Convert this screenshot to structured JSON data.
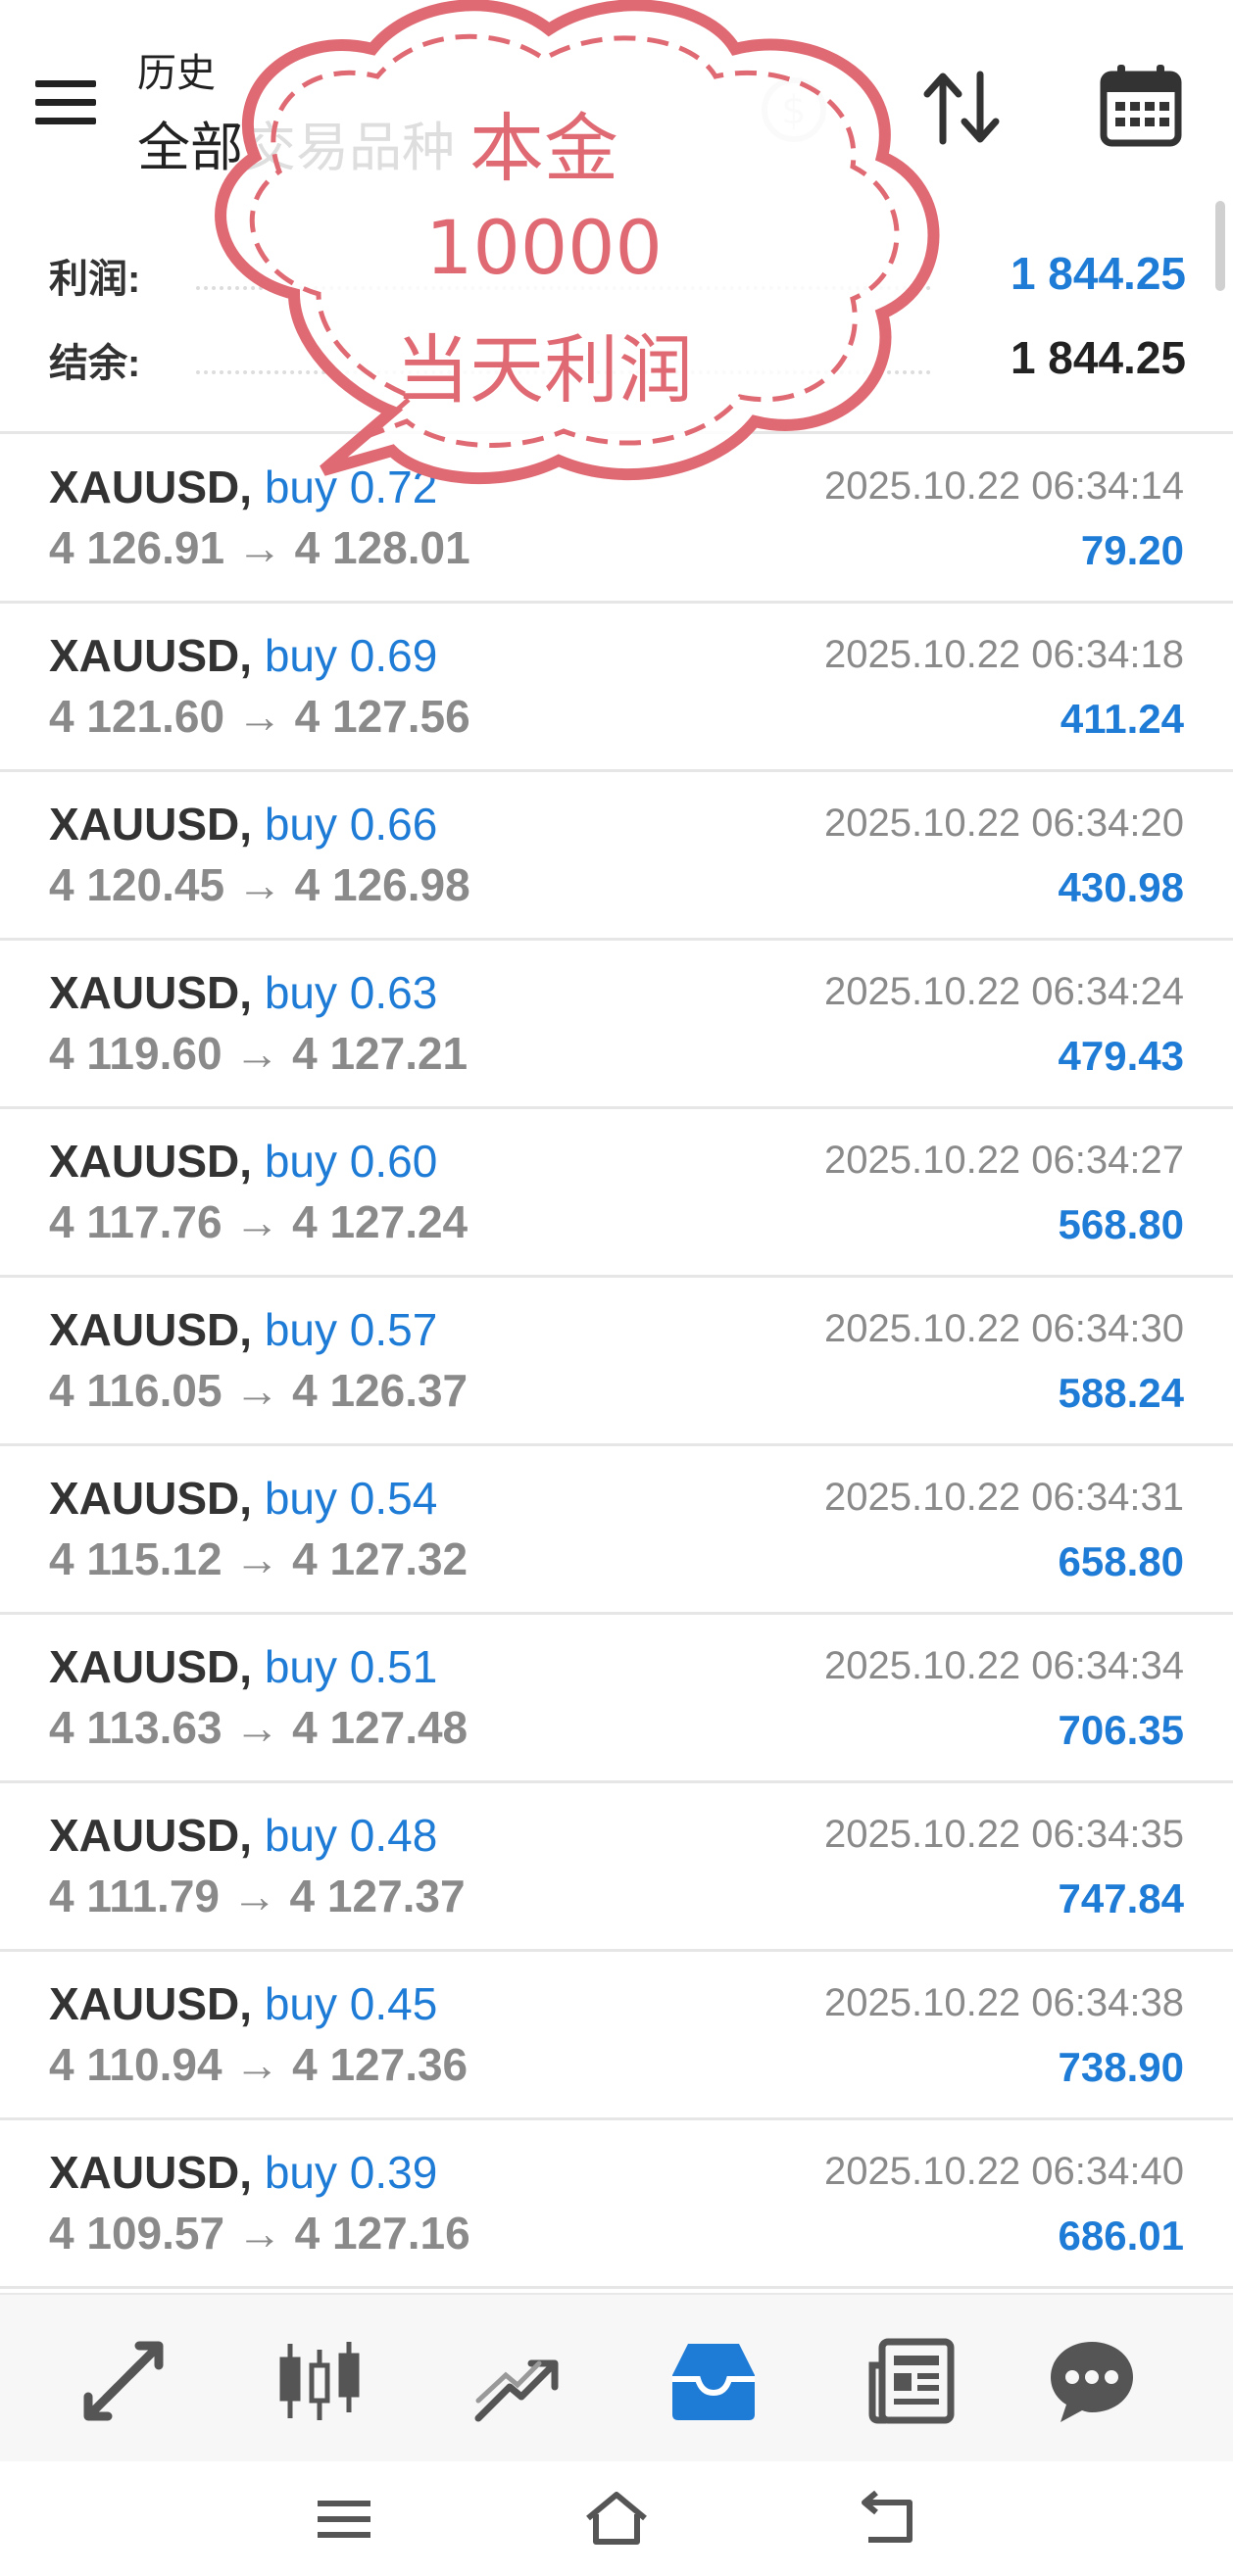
{
  "header": {
    "title_small": "历史",
    "title_big": "全部交易品种",
    "icons": [
      "menu-icon",
      "money-icon",
      "sort-icon",
      "calendar-icon"
    ]
  },
  "summary": {
    "profit_label": "利润:",
    "profit_value": "1 844.25",
    "balance_label": "结余:",
    "balance_value": "1 844.25"
  },
  "overlay": {
    "line1": "本金",
    "line2": "10000",
    "line3": "当天利润",
    "color": "#e06a73"
  },
  "colors": {
    "accent": "#1e7bd6",
    "muted": "#8a8a8a",
    "text": "#333333"
  },
  "trades": [
    {
      "symbol": "XAUUSD,",
      "side": "buy 0.72",
      "prices": "4 126.91 → 4 128.01",
      "time": "2025.10.22 06:34:14",
      "profit": "79.20"
    },
    {
      "symbol": "XAUUSD,",
      "side": "buy 0.69",
      "prices": "4 121.60 → 4 127.56",
      "time": "2025.10.22 06:34:18",
      "profit": "411.24"
    },
    {
      "symbol": "XAUUSD,",
      "side": "buy 0.66",
      "prices": "4 120.45 → 4 126.98",
      "time": "2025.10.22 06:34:20",
      "profit": "430.98"
    },
    {
      "symbol": "XAUUSD,",
      "side": "buy 0.63",
      "prices": "4 119.60 → 4 127.21",
      "time": "2025.10.22 06:34:24",
      "profit": "479.43"
    },
    {
      "symbol": "XAUUSD,",
      "side": "buy 0.60",
      "prices": "4 117.76 → 4 127.24",
      "time": "2025.10.22 06:34:27",
      "profit": "568.80"
    },
    {
      "symbol": "XAUUSD,",
      "side": "buy 0.57",
      "prices": "4 116.05 → 4 126.37",
      "time": "2025.10.22 06:34:30",
      "profit": "588.24"
    },
    {
      "symbol": "XAUUSD,",
      "side": "buy 0.54",
      "prices": "4 115.12 → 4 127.32",
      "time": "2025.10.22 06:34:31",
      "profit": "658.80"
    },
    {
      "symbol": "XAUUSD,",
      "side": "buy 0.51",
      "prices": "4 113.63 → 4 127.48",
      "time": "2025.10.22 06:34:34",
      "profit": "706.35"
    },
    {
      "symbol": "XAUUSD,",
      "side": "buy 0.48",
      "prices": "4 111.79 → 4 127.37",
      "time": "2025.10.22 06:34:35",
      "profit": "747.84"
    },
    {
      "symbol": "XAUUSD,",
      "side": "buy 0.45",
      "prices": "4 110.94 → 4 127.36",
      "time": "2025.10.22 06:34:38",
      "profit": "738.90"
    },
    {
      "symbol": "XAUUSD,",
      "side": "buy 0.39",
      "prices": "4 109.57 → 4 127.16",
      "time": "2025.10.22 06:34:40",
      "profit": "686.01"
    }
  ],
  "bottom_nav": {
    "items": [
      "quotes-icon",
      "chart-icon",
      "trade-icon",
      "history-icon",
      "news-icon",
      "chat-icon"
    ],
    "active": "history-icon"
  },
  "system_nav": [
    "recent-apps-icon",
    "home-icon",
    "back-icon"
  ]
}
